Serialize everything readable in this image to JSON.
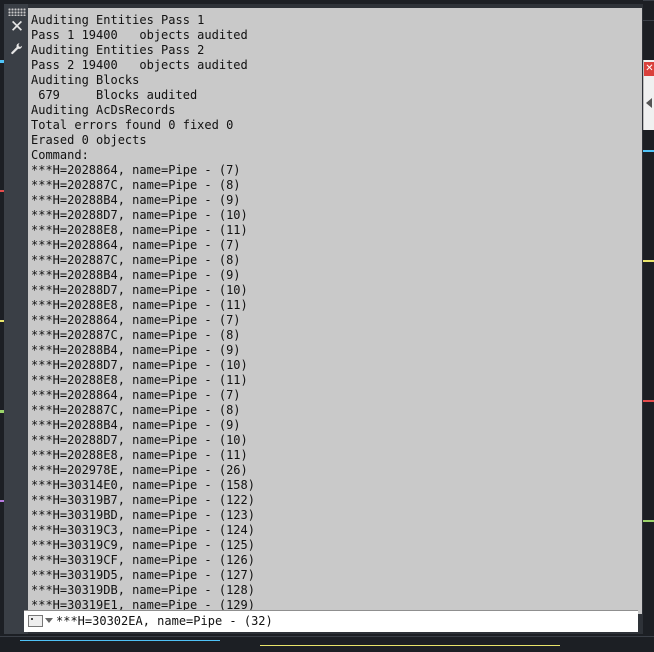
{
  "command_line": {
    "history": [
      "Auditing Entities Pass 1",
      "Pass 1 19400   objects audited",
      "Auditing Entities Pass 2",
      "Pass 2 19400   objects audited",
      "Auditing Blocks",
      " 679     Blocks audited",
      "Auditing AcDsRecords",
      "Total errors found 0 fixed 0",
      "Erased 0 objects",
      "Command:",
      "***H=2028864, name=Pipe - (7)",
      "***H=202887C, name=Pipe - (8)",
      "***H=20288B4, name=Pipe - (9)",
      "***H=20288D7, name=Pipe - (10)",
      "***H=20288E8, name=Pipe - (11)",
      "***H=2028864, name=Pipe - (7)",
      "***H=202887C, name=Pipe - (8)",
      "***H=20288B4, name=Pipe - (9)",
      "***H=20288D7, name=Pipe - (10)",
      "***H=20288E8, name=Pipe - (11)",
      "***H=2028864, name=Pipe - (7)",
      "***H=202887C, name=Pipe - (8)",
      "***H=20288B4, name=Pipe - (9)",
      "***H=20288D7, name=Pipe - (10)",
      "***H=20288E8, name=Pipe - (11)",
      "***H=2028864, name=Pipe - (7)",
      "***H=202887C, name=Pipe - (8)",
      "***H=20288B4, name=Pipe - (9)",
      "***H=20288D7, name=Pipe - (10)",
      "***H=20288E8, name=Pipe - (11)",
      "***H=202978E, name=Pipe - (26)",
      "***H=30314E0, name=Pipe - (158)",
      "***H=30319B7, name=Pipe - (122)",
      "***H=30319BD, name=Pipe - (123)",
      "***H=30319C3, name=Pipe - (124)",
      "***H=30319C9, name=Pipe - (125)",
      "***H=30319CF, name=Pipe - (126)",
      "***H=30319D5, name=Pipe - (127)",
      "***H=30319DB, name=Pipe - (128)",
      "***H=30319E1, name=Pipe - (129)"
    ],
    "current_input": "***H=30302EA, name=Pipe - (32)"
  },
  "icons": {
    "grip": "grip-icon",
    "close": "close-icon",
    "settings": "wrench-icon",
    "prompt": "command-prompt-icon",
    "recent": "chevron-down-icon",
    "panel_close": "close-icon",
    "panel_collapse": "triangle-left-icon"
  },
  "glyphs": {
    "close": "✕",
    "settings": "🔧",
    "panel_close": "✕"
  },
  "colors": {
    "history_bg": "#c9c9c9",
    "frame": "#3a3f46",
    "input_bg": "#ffffff"
  }
}
